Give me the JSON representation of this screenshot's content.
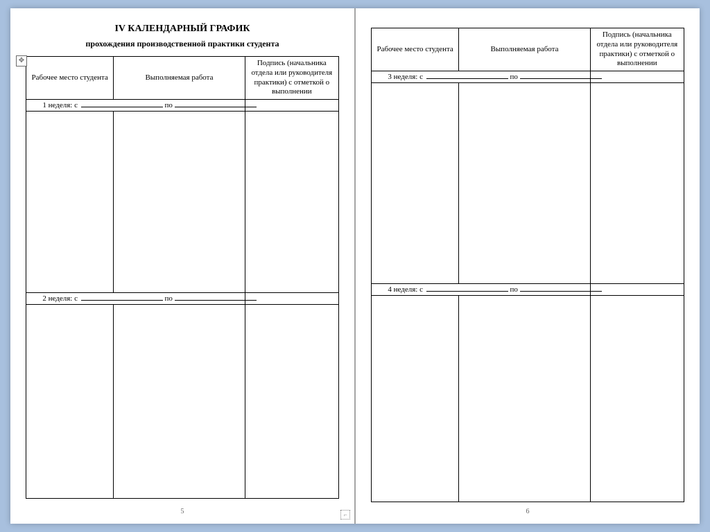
{
  "title": "IV КАЛЕНДАРНЫЙ ГРАФИК",
  "subtitle": "прохождения производственной практики студента",
  "columns": {
    "c1": "Рабочее место студента",
    "c2": "Выполняемая работа",
    "c3": "Подпись (начальника отдела или руководителя практики) с отметкой о выполнении"
  },
  "weeks": {
    "w1_label": "1 неделя: с",
    "w2_label": "2 неделя: с",
    "w3_label": "3 неделя: с",
    "w4_label": "4 неделя: с",
    "to": "по"
  },
  "page_numbers": {
    "left": "5",
    "right": "6"
  },
  "glyphs": {
    "anchor": "✥",
    "break": "⌐"
  }
}
